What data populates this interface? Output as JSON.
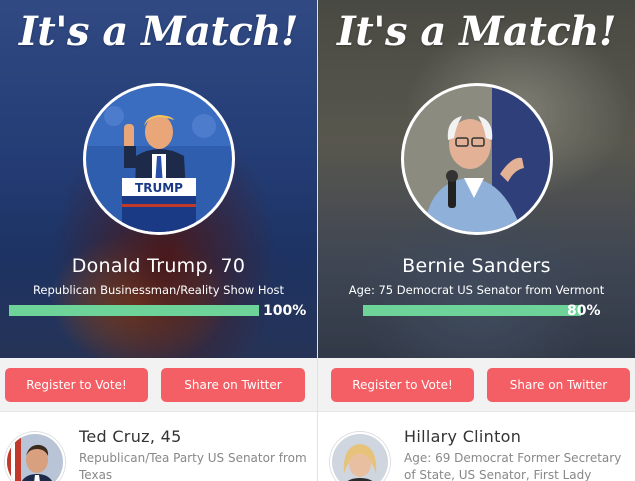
{
  "colors": {
    "accent": "#f35f65",
    "progress": "#6ed398",
    "text_dark": "#333333",
    "text_muted": "#888888"
  },
  "panels": [
    {
      "title": "It's a Match!",
      "candidate_name": "Donald Trump, 70",
      "candidate_desc": "Republican Businessman/Reality Show Host",
      "match_percent_label": "100%",
      "match_fraction": 1.0,
      "podium_sign": "TRUMP",
      "register_label": "Register to Vote!",
      "share_label": "Share on Twitter",
      "next": {
        "name": "Ted Cruz, 45",
        "desc": "Republican/Tea Party US Senator from Texas"
      }
    },
    {
      "title": "It's a Match!",
      "candidate_name": "Bernie Sanders",
      "candidate_desc": "Age: 75 Democrat US Senator from Vermont",
      "match_percent_label": "80%",
      "match_fraction": 0.8,
      "register_label": "Register to Vote!",
      "share_label": "Share on Twitter",
      "next": {
        "name": "Hillary Clinton",
        "desc": "Age: 69 Democrat Former Secretary of State, US Senator, First Lady"
      }
    }
  ]
}
